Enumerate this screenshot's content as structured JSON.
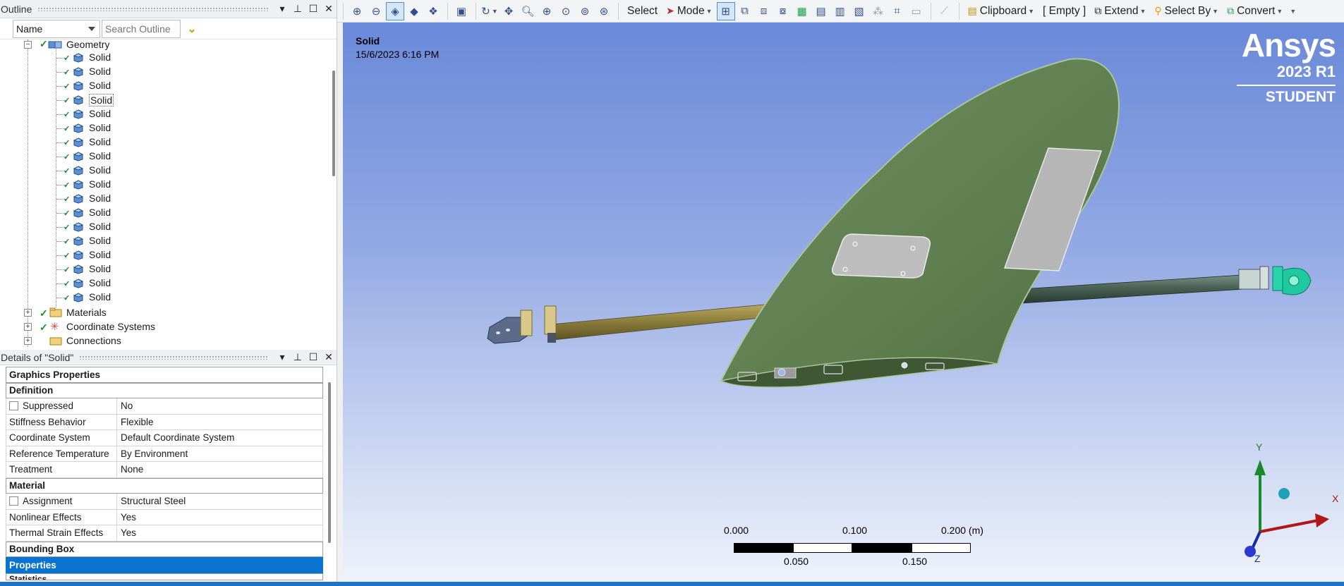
{
  "outline": {
    "title": "Outline",
    "name_combo": "Name",
    "search_placeholder": "Search Outline",
    "geometry_label": "Geometry",
    "solids": [
      "Solid",
      "Solid",
      "Solid",
      "Solid",
      "Solid",
      "Solid",
      "Solid",
      "Solid",
      "Solid",
      "Solid",
      "Solid",
      "Solid",
      "Solid",
      "Solid",
      "Solid",
      "Solid",
      "Solid",
      "Solid"
    ],
    "materials_label": "Materials",
    "coord_label": "Coordinate Systems",
    "connections_label": "Connections"
  },
  "details": {
    "title": "Details of \"Solid\"",
    "sections": {
      "graphics": "Graphics Properties",
      "definition": "Definition",
      "material": "Material",
      "bounding": "Bounding Box",
      "properties": "Properties",
      "statistics": "Statistics"
    },
    "rows": {
      "suppressed": {
        "k": "Suppressed",
        "v": "No"
      },
      "stiffness": {
        "k": "Stiffness Behavior",
        "v": "Flexible"
      },
      "coord": {
        "k": "Coordinate System",
        "v": "Default Coordinate System"
      },
      "reftemp": {
        "k": "Reference Temperature",
        "v": "By Environment"
      },
      "treatment": {
        "k": "Treatment",
        "v": "None"
      },
      "assignment": {
        "k": "Assignment",
        "v": "Structural Steel"
      },
      "nonlinear": {
        "k": "Nonlinear Effects",
        "v": "Yes"
      },
      "thermal": {
        "k": "Thermal Strain Effects",
        "v": "Yes"
      }
    }
  },
  "toolbar": {
    "select": "Select",
    "mode": "Mode",
    "clipboard": "Clipboard",
    "empty": "[ Empty ]",
    "extend": "Extend",
    "select_by": "Select By",
    "convert": "Convert"
  },
  "viewport": {
    "title": "Solid",
    "date": "15/6/2023 6:16 PM",
    "brand_name": "Ansys",
    "brand_version": "2023 R1",
    "brand_edition": "STUDENT",
    "scale": {
      "l0": "0.000",
      "l1": "0.100",
      "l2": "0.200 (m)",
      "m1": "0.050",
      "m2": "0.150"
    },
    "axes": {
      "x": "X",
      "y": "Y",
      "z": "Z"
    }
  },
  "colors": {
    "accent": "#0a73d1",
    "wing": "#5f7f50",
    "rod_left": "#8a7a3a",
    "rod_right": "#3d5a48",
    "clip": "#1fc9a0"
  }
}
